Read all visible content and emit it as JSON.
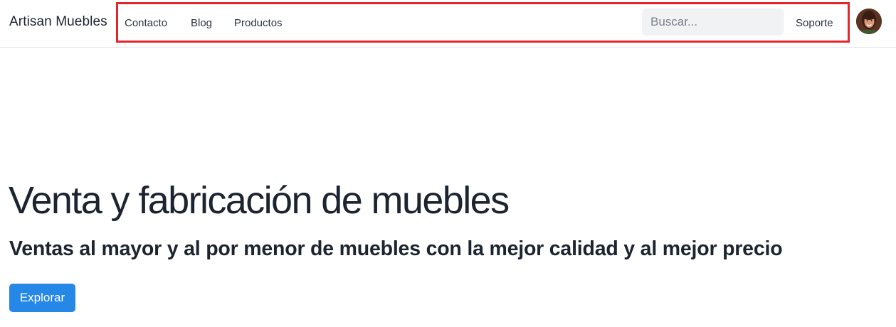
{
  "navbar": {
    "brand": "Artisan Muebles",
    "links": [
      {
        "label": "Contacto"
      },
      {
        "label": "Blog"
      },
      {
        "label": "Productos"
      }
    ],
    "search": {
      "placeholder": "Buscar...",
      "value": ""
    },
    "support_label": "Soporte",
    "highlight_color": "#e3262a"
  },
  "hero": {
    "title": "Venta y fabricación de muebles",
    "subtitle": "Ventas al mayor y al por menor de muebles con la mejor calidad y al mejor precio",
    "cta_label": "Explorar",
    "cta_color": "#2688e6"
  }
}
